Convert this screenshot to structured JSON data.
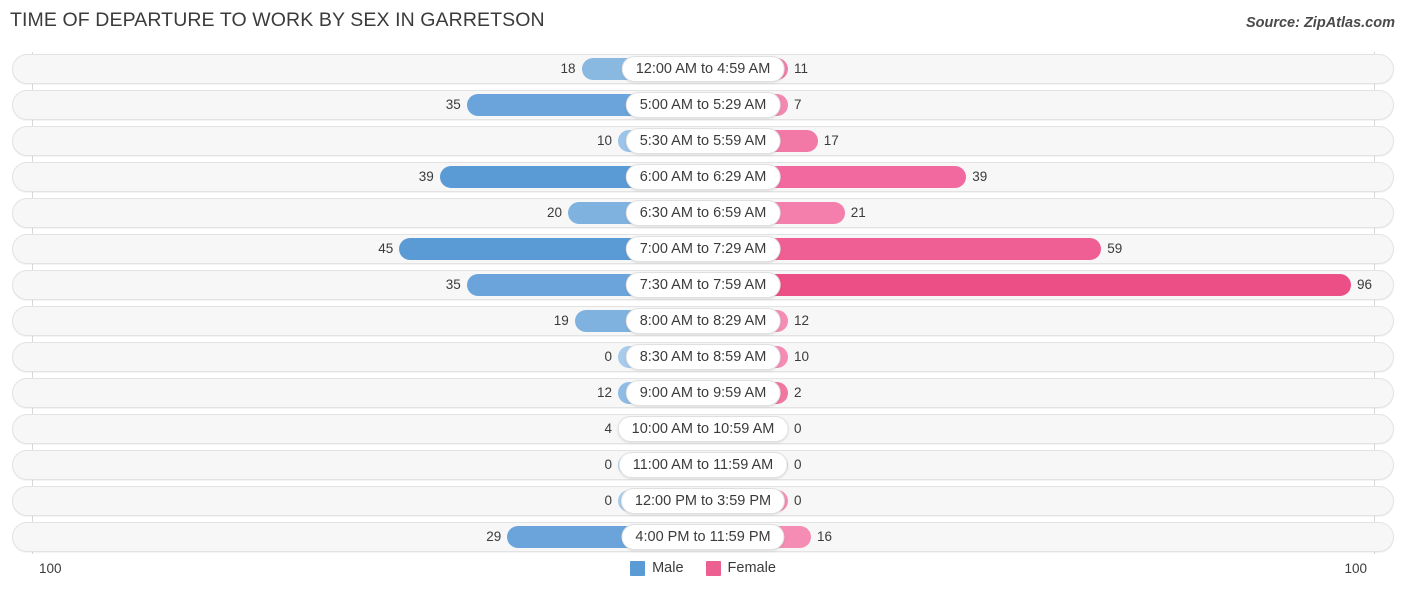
{
  "header": {
    "title": "TIME OF DEPARTURE TO WORK BY SEX IN GARRETSON",
    "source": "Source: ZipAtlas.com"
  },
  "legend": {
    "male_label": "Male",
    "female_label": "Female",
    "male_color": "#5b9bd5",
    "female_color": "#ec5f91"
  },
  "axis": {
    "left_label": "100",
    "right_label": "100"
  },
  "chart_data": {
    "type": "bar",
    "orientation": "horizontal-diverging",
    "title": "TIME OF DEPARTURE TO WORK BY SEX IN GARRETSON",
    "xlabel": "",
    "ylabel": "",
    "xlim": [
      100,
      100
    ],
    "grid": false,
    "legend_position": "bottom-center",
    "categories": [
      "12:00 AM to 4:59 AM",
      "5:00 AM to 5:29 AM",
      "5:30 AM to 5:59 AM",
      "6:00 AM to 6:29 AM",
      "6:30 AM to 6:59 AM",
      "7:00 AM to 7:29 AM",
      "7:30 AM to 7:59 AM",
      "8:00 AM to 8:29 AM",
      "8:30 AM to 8:59 AM",
      "9:00 AM to 9:59 AM",
      "10:00 AM to 10:59 AM",
      "11:00 AM to 11:59 AM",
      "12:00 PM to 3:59 PM",
      "4:00 PM to 11:59 PM"
    ],
    "series": [
      {
        "name": "Male",
        "color": "#5b9bd5",
        "values": [
          18,
          35,
          10,
          39,
          20,
          45,
          35,
          19,
          0,
          12,
          4,
          0,
          0,
          29
        ]
      },
      {
        "name": "Female",
        "color": "#ec5f91",
        "values": [
          11,
          7,
          17,
          39,
          21,
          59,
          96,
          12,
          10,
          2,
          0,
          0,
          0,
          16
        ]
      }
    ]
  },
  "rows": [
    {
      "category": "12:00 AM to 4:59 AM",
      "male": "18",
      "female": "11",
      "male_color": "#89b8e0",
      "female_color": "#f07faa"
    },
    {
      "category": "5:00 AM to 5:29 AM",
      "male": "35",
      "female": "7",
      "male_color": "#6ba4da",
      "female_color": "#f288b0"
    },
    {
      "category": "5:30 AM to 5:59 AM",
      "male": "10",
      "female": "17",
      "male_color": "#9cc4e8",
      "female_color": "#f278a6"
    },
    {
      "category": "6:00 AM to 6:29 AM",
      "male": "39",
      "female": "39",
      "male_color": "#5b9bd5",
      "female_color": "#f1699f"
    },
    {
      "category": "6:30 AM to 6:59 AM",
      "male": "20",
      "female": "21",
      "male_color": "#7fb2de",
      "female_color": "#f57fac"
    },
    {
      "category": "7:00 AM to 7:29 AM",
      "male": "45",
      "female": "59",
      "male_color": "#5b9bd5",
      "female_color": "#ef5f93"
    },
    {
      "category": "7:30 AM to 7:59 AM",
      "male": "35",
      "female": "96",
      "male_color": "#6ba4da",
      "female_color": "#ec4f86"
    },
    {
      "category": "8:00 AM to 8:29 AM",
      "male": "19",
      "female": "12",
      "male_color": "#7fb2de",
      "female_color": "#f58cb4"
    },
    {
      "category": "8:30 AM to 8:59 AM",
      "male": "0",
      "female": "10",
      "male_color": "#a8cbeb",
      "female_color": "#f58cb4"
    },
    {
      "category": "9:00 AM to 9:59 AM",
      "male": "12",
      "female": "2",
      "male_color": "#8fbce4",
      "female_color": "#f2779f"
    },
    {
      "category": "10:00 AM to 10:59 AM",
      "male": "4",
      "female": "0",
      "male_color": "#9cc4e8",
      "female_color": "#f58cb4"
    },
    {
      "category": "11:00 AM to 11:59 AM",
      "male": "0",
      "female": "0",
      "male_color": "#a8cbeb",
      "female_color": "#f58cb4"
    },
    {
      "category": "12:00 PM to 3:59 PM",
      "male": "0",
      "female": "0",
      "male_color": "#a8cbeb",
      "female_color": "#f58cb4"
    },
    {
      "category": "4:00 PM to 11:59 PM",
      "male": "29",
      "female": "16",
      "male_color": "#6ba4da",
      "female_color": "#f58cb4"
    }
  ]
}
